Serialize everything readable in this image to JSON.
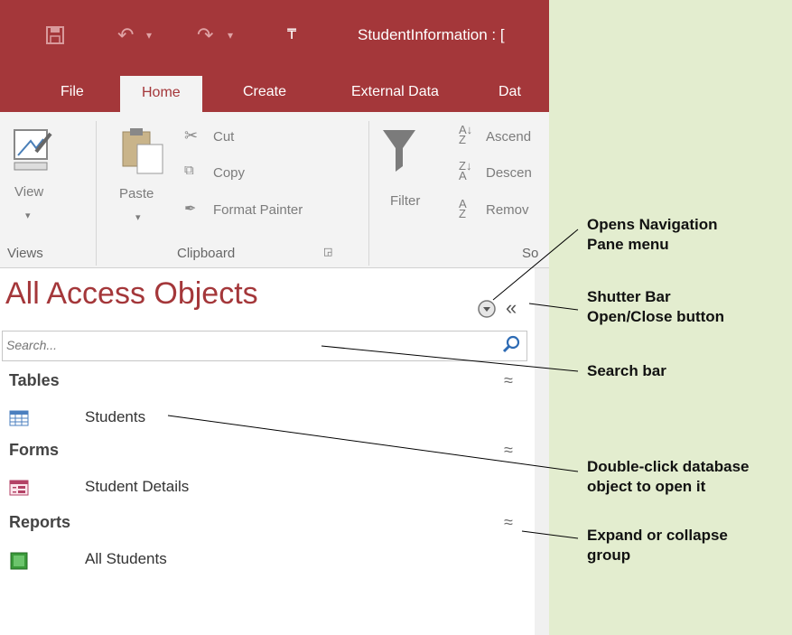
{
  "window": {
    "title": "StudentInformation : [",
    "qat": {
      "save_icon": "save-icon",
      "undo_icon": "undo-icon",
      "redo_icon": "redo-icon",
      "customize_icon": "customize-qat-icon"
    }
  },
  "tabs": [
    {
      "label": "File"
    },
    {
      "label": "Home"
    },
    {
      "label": "Create"
    },
    {
      "label": "External Data"
    },
    {
      "label": "Dat"
    }
  ],
  "ribbon": {
    "views": {
      "view_label": "View",
      "group": "Views"
    },
    "clipboard": {
      "paste_label": "Paste",
      "cut_label": "Cut",
      "copy_label": "Copy",
      "format_painter_label": "Format Painter",
      "group": "Clipboard"
    },
    "sort": {
      "filter_label": "Filter",
      "ascending_label": "Ascend",
      "descending_label": "Descen",
      "remove_label": "Remov",
      "group": "So"
    }
  },
  "navigation_pane": {
    "title": "All Access Objects",
    "search_placeholder": "Search...",
    "groups": [
      {
        "name": "Tables",
        "items": [
          {
            "label": "Students",
            "icon": "table-icon"
          }
        ]
      },
      {
        "name": "Forms",
        "items": [
          {
            "label": "Student Details",
            "icon": "form-icon"
          }
        ]
      },
      {
        "name": "Reports",
        "items": [
          {
            "label": "All Students",
            "icon": "report-icon"
          }
        ]
      }
    ]
  },
  "annotations": [
    {
      "text": "Opens Navigation\nPane menu"
    },
    {
      "text": "Shutter Bar\nOpen/Close button"
    },
    {
      "text": "Search bar"
    },
    {
      "text": "Double-click database\nobject to open it"
    },
    {
      "text": "Expand or collapse\ngroup"
    }
  ],
  "colors": {
    "access_red": "#a4373a",
    "background": "#e3edcf",
    "ribbon": "#f3f3f3"
  }
}
